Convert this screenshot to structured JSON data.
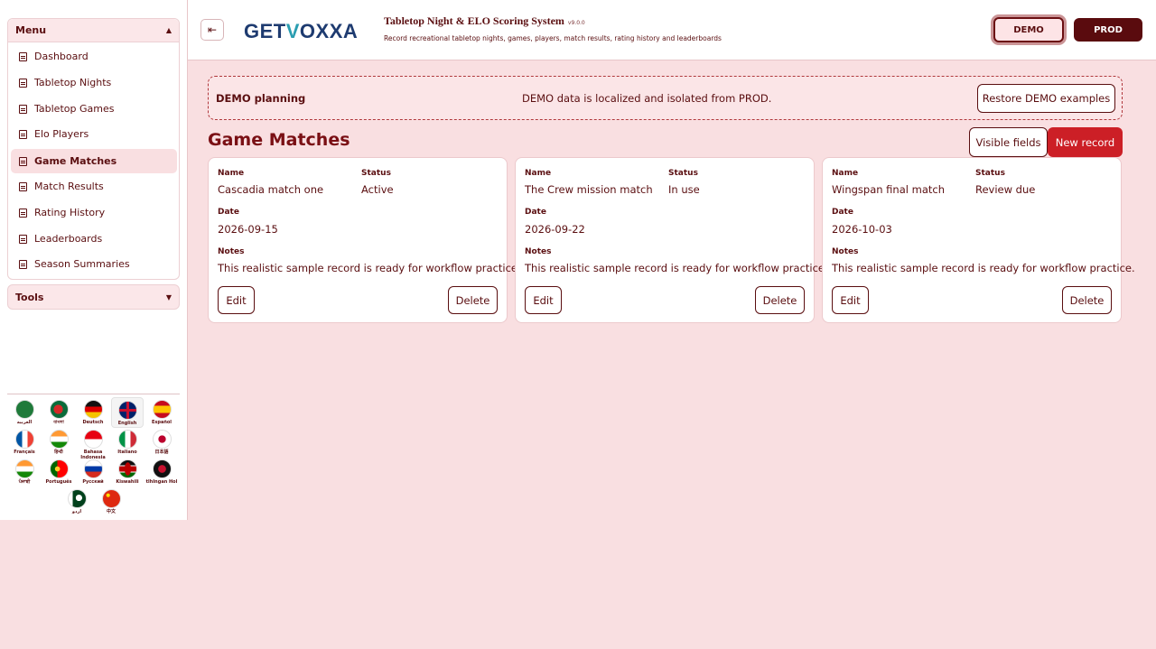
{
  "sidebar": {
    "menu_label": "Menu",
    "tools_label": "Tools",
    "items": [
      {
        "label": "Dashboard"
      },
      {
        "label": "Tabletop Nights"
      },
      {
        "label": "Tabletop Games"
      },
      {
        "label": "Elo Players"
      },
      {
        "label": "Game Matches",
        "active": true
      },
      {
        "label": "Match Results"
      },
      {
        "label": "Rating History"
      },
      {
        "label": "Leaderboards"
      },
      {
        "label": "Season Summaries"
      }
    ],
    "languages": [
      {
        "name": "العربية"
      },
      {
        "name": "বাংলা"
      },
      {
        "name": "Deutsch"
      },
      {
        "name": "English"
      },
      {
        "name": "Español"
      },
      {
        "name": "Français"
      },
      {
        "name": "हिन्दी"
      },
      {
        "name": "Bahasa Indonesia"
      },
      {
        "name": "Italiano"
      },
      {
        "name": "日本語"
      },
      {
        "name": "ਪੰਜਾਬੀ"
      },
      {
        "name": "Português"
      },
      {
        "name": "Русский"
      },
      {
        "name": "Kiswahili"
      },
      {
        "name": "tlhIngan Hol"
      },
      {
        "name": "اردو"
      },
      {
        "name": "中文"
      }
    ]
  },
  "header": {
    "logo_pre": "GET",
    "logo_v": "V",
    "logo_post": "OXXA",
    "title": "Tabletop Night & ELO Scoring System",
    "version": "v9.0.0",
    "subtitle": "Record recreational tabletop nights, games, players, match results, rating history and leaderboards",
    "env_demo": "DEMO",
    "env_prod": "PROD"
  },
  "banner": {
    "title": "DEMO planning",
    "message": "DEMO data is localized and isolated from PROD.",
    "restore_label": "Restore DEMO examples"
  },
  "section": {
    "title": "Game Matches",
    "visible_fields_label": "Visible fields",
    "new_record_label": "New record"
  },
  "labels": {
    "name": "Name",
    "status": "Status",
    "date": "Date",
    "notes": "Notes",
    "edit": "Edit",
    "delete": "Delete"
  },
  "records": [
    {
      "name": "Cascadia match one",
      "status": "Active",
      "date": "2026-09-15",
      "notes": "This realistic sample record is ready for workflow practice."
    },
    {
      "name": "The Crew mission match",
      "status": "In use",
      "date": "2026-09-22",
      "notes": "This realistic sample record is ready for workflow practice."
    },
    {
      "name": "Wingspan final match",
      "status": "Review due",
      "date": "2026-10-03",
      "notes": "This realistic sample record is ready for workflow practice."
    }
  ]
}
